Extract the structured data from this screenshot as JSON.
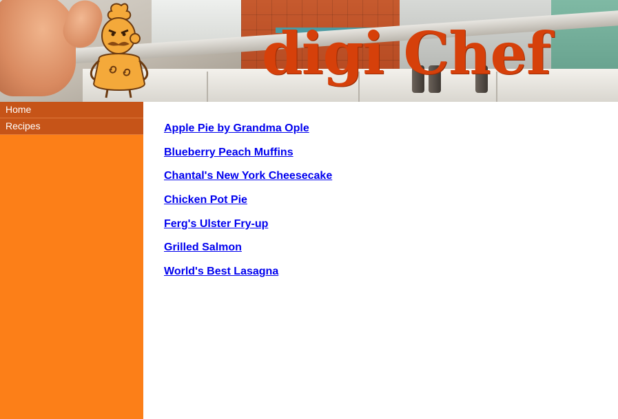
{
  "banner": {
    "logo_text": "digi Chef",
    "brand_color": "#d6400a",
    "mascot_icon": "chef-mascot-icon"
  },
  "sidebar": {
    "background_color": "#fc7f18",
    "item_color": "#c65418",
    "items": [
      {
        "label": "Home"
      },
      {
        "label": "Recipes"
      }
    ]
  },
  "main": {
    "link_color": "#0000ee",
    "recipes": [
      {
        "title": "Apple Pie by Grandma Ople"
      },
      {
        "title": "Blueberry Peach Muffins"
      },
      {
        "title": "Chantal's New York Cheesecake"
      },
      {
        "title": "Chicken Pot Pie"
      },
      {
        "title": "Ferg's Ulster Fry-up"
      },
      {
        "title": "Grilled Salmon"
      },
      {
        "title": "World's Best Lasagna"
      }
    ]
  }
}
